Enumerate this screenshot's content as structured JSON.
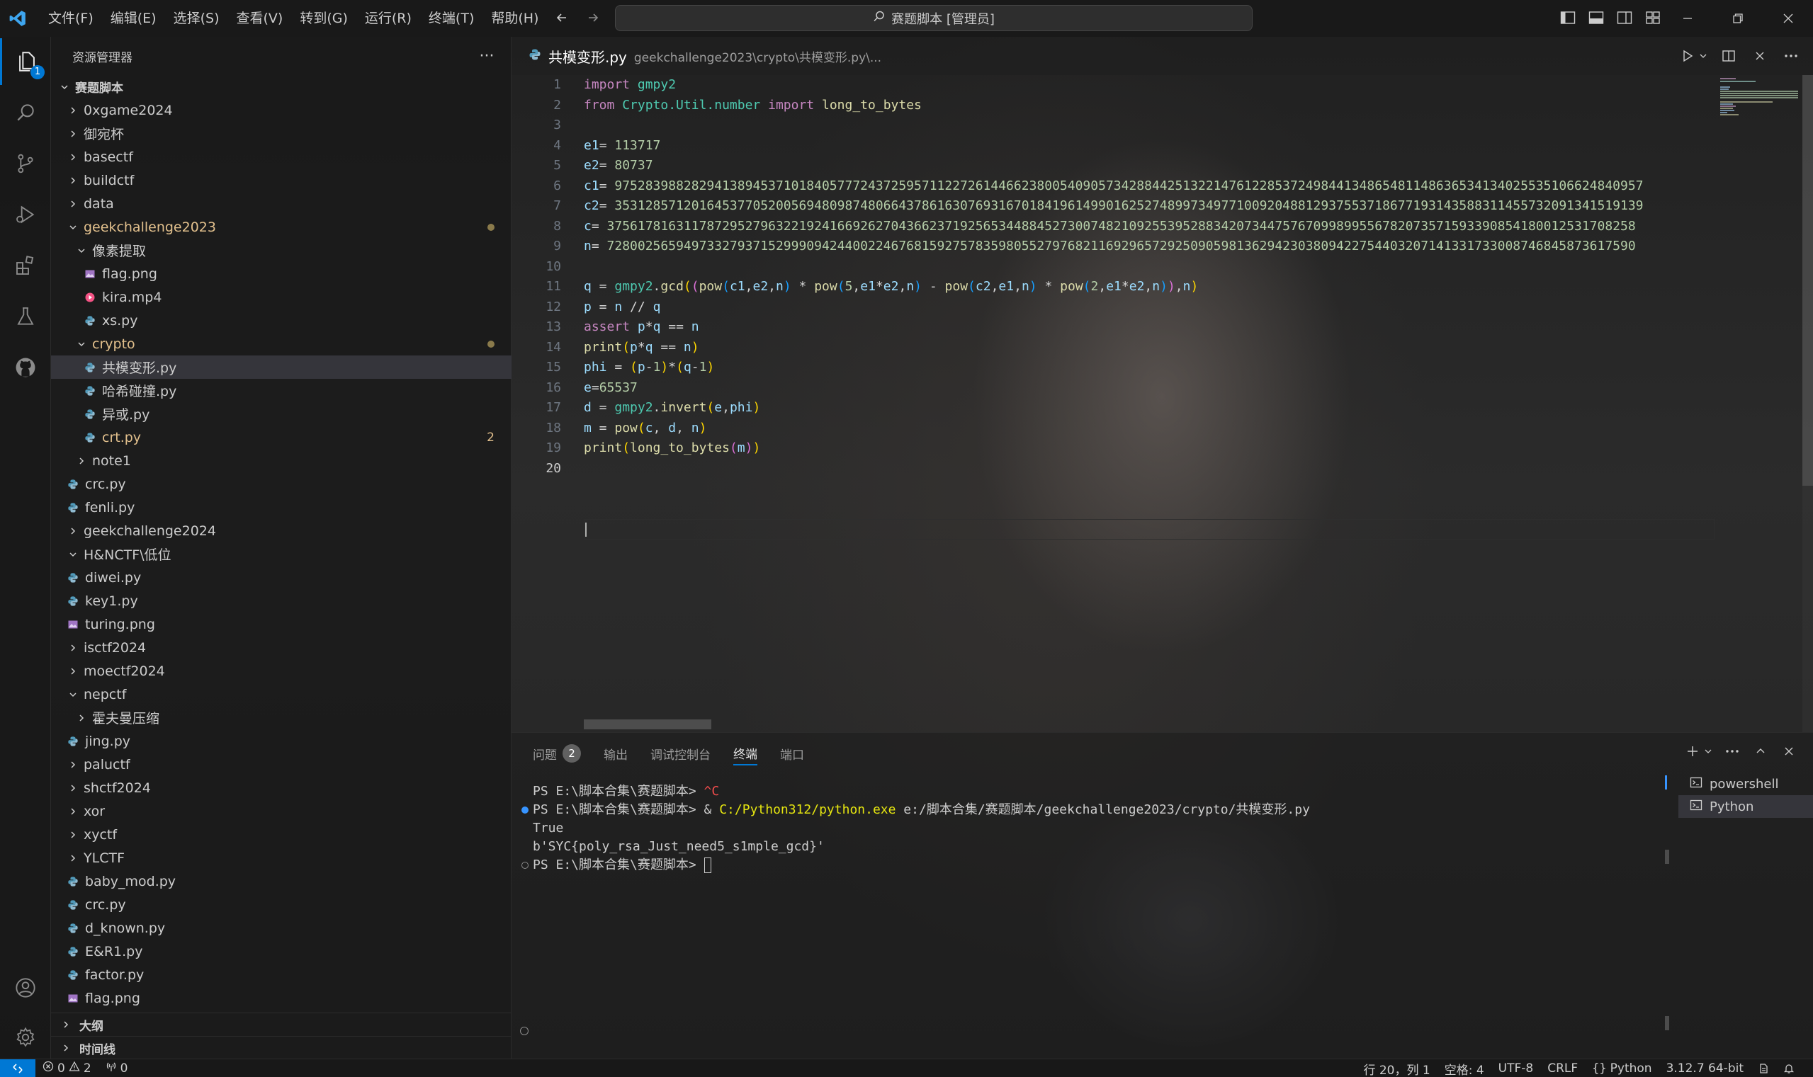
{
  "titlebar": {
    "menu": [
      "文件(F)",
      "编辑(E)",
      "选择(S)",
      "查看(V)",
      "转到(G)",
      "运行(R)",
      "终端(T)",
      "帮助(H)"
    ],
    "command_center": "赛题脚本 [管理员]"
  },
  "activity": {
    "explorer_badge": "1"
  },
  "sidebar": {
    "title": "资源管理器",
    "more": "···",
    "tree": [
      {
        "label": "赛题脚本",
        "depth": 0,
        "type": "root",
        "chev": "open"
      },
      {
        "label": "0xgame2024",
        "depth": 1,
        "type": "folder",
        "chev": "closed"
      },
      {
        "label": "御宛杯",
        "depth": 1,
        "type": "folder",
        "chev": "closed"
      },
      {
        "label": "basectf",
        "depth": 1,
        "type": "folder",
        "chev": "closed"
      },
      {
        "label": "buildctf",
        "depth": 1,
        "type": "folder",
        "chev": "closed"
      },
      {
        "label": "data",
        "depth": 1,
        "type": "folder",
        "chev": "closed"
      },
      {
        "label": "geekchallenge2023",
        "depth": 1,
        "type": "folder",
        "chev": "open",
        "modified": true,
        "dot": true
      },
      {
        "label": "像素提取",
        "depth": 2,
        "type": "folder",
        "chev": "open"
      },
      {
        "label": "flag.png",
        "depth": 3,
        "type": "image"
      },
      {
        "label": "kira.mp4",
        "depth": 3,
        "type": "video"
      },
      {
        "label": "xs.py",
        "depth": 3,
        "type": "python"
      },
      {
        "label": "crypto",
        "depth": 2,
        "type": "folder",
        "chev": "open",
        "modified": true,
        "dot": true
      },
      {
        "label": "共模变形.py",
        "depth": 3,
        "type": "python",
        "selected": true
      },
      {
        "label": "哈希碰撞.py",
        "depth": 3,
        "type": "python"
      },
      {
        "label": "异或.py",
        "depth": 3,
        "type": "python"
      },
      {
        "label": "crt.py",
        "depth": 3,
        "type": "python",
        "modified": true,
        "count": "2"
      },
      {
        "label": "note1",
        "depth": 2,
        "type": "folder",
        "chev": "closed"
      },
      {
        "label": "crc.py",
        "depth": 2,
        "type": "python"
      },
      {
        "label": "fenli.py",
        "depth": 2,
        "type": "python"
      },
      {
        "label": "geekchallenge2024",
        "depth": 1,
        "type": "folder",
        "chev": "closed"
      },
      {
        "label": "H&NCTF\\低位",
        "depth": 1,
        "type": "folder",
        "chev": "open"
      },
      {
        "label": "diwei.py",
        "depth": 2,
        "type": "python"
      },
      {
        "label": "key1.py",
        "depth": 2,
        "type": "python"
      },
      {
        "label": "turing.png",
        "depth": 2,
        "type": "image"
      },
      {
        "label": "isctf2024",
        "depth": 1,
        "type": "folder",
        "chev": "closed"
      },
      {
        "label": "moectf2024",
        "depth": 1,
        "type": "folder",
        "chev": "closed"
      },
      {
        "label": "nepctf",
        "depth": 1,
        "type": "folder",
        "chev": "open"
      },
      {
        "label": "霍夫曼压缩",
        "depth": 2,
        "type": "folder",
        "chev": "closed"
      },
      {
        "label": "jing.py",
        "depth": 2,
        "type": "python"
      },
      {
        "label": "paluctf",
        "depth": 1,
        "type": "folder",
        "chev": "closed"
      },
      {
        "label": "shctf2024",
        "depth": 1,
        "type": "folder",
        "chev": "closed"
      },
      {
        "label": "xor",
        "depth": 1,
        "type": "folder",
        "chev": "closed"
      },
      {
        "label": "xyctf",
        "depth": 1,
        "type": "folder",
        "chev": "closed"
      },
      {
        "label": "YLCTF",
        "depth": 1,
        "type": "folder",
        "chev": "closed"
      },
      {
        "label": "baby_mod.py",
        "depth": 1,
        "type": "python"
      },
      {
        "label": "crc.py",
        "depth": 1,
        "type": "python"
      },
      {
        "label": "d_known.py",
        "depth": 1,
        "type": "python"
      },
      {
        "label": "E&R1.py",
        "depth": 1,
        "type": "python"
      },
      {
        "label": "factor.py",
        "depth": 1,
        "type": "python"
      },
      {
        "label": "flag.png",
        "depth": 1,
        "type": "image"
      }
    ],
    "outline": "大纲",
    "timeline": "时间线"
  },
  "editor": {
    "tab_title": "共模变形.py",
    "tab_path": "geekchallenge2023\\crypto\\共模变形.py\\...",
    "current_line": 20,
    "lines": [
      [
        [
          "kw",
          "import"
        ],
        [
          "op",
          " "
        ],
        [
          "mod",
          "gmpy2"
        ]
      ],
      [
        [
          "kw",
          "from"
        ],
        [
          "op",
          " "
        ],
        [
          "mod",
          "Crypto.Util.number"
        ],
        [
          "op",
          " "
        ],
        [
          "kw",
          "import"
        ],
        [
          "op",
          " "
        ],
        [
          "fn",
          "long_to_bytes"
        ]
      ],
      [],
      [
        [
          "var",
          "e1"
        ],
        [
          "op",
          "= "
        ],
        [
          "num",
          "113717"
        ]
      ],
      [
        [
          "var",
          "e2"
        ],
        [
          "op",
          "= "
        ],
        [
          "num",
          "80737"
        ]
      ],
      [
        [
          "var",
          "c1"
        ],
        [
          "op",
          "= "
        ],
        [
          "num",
          "97528398828294138945371018405777243725957112272614466238005409057342884425132214761228537249844134865481148636534134025535106624840957"
        ]
      ],
      [
        [
          "var",
          "c2"
        ],
        [
          "op",
          "= "
        ],
        [
          "num",
          "35312857120164537705200569480987480664378616307693167018419614990162527489973497710092048812937553718677193143588311455732091341519139"
        ]
      ],
      [
        [
          "var",
          "c"
        ],
        [
          "op",
          "= "
        ],
        [
          "num",
          "37561781631178729527963221924166926270436623719256534488452730074821092553952883420734475767099899556782073571593390854180012531708258"
        ]
      ],
      [
        [
          "var",
          "n"
        ],
        [
          "op",
          "= "
        ],
        [
          "num",
          "72800256594973327937152999094244002246768159275783598055279768211692965729250905981362942303809422754403207141331733008746845873617590"
        ]
      ],
      [],
      [
        [
          "var",
          "q"
        ],
        [
          "op",
          " = "
        ],
        [
          "mod",
          "gmpy2"
        ],
        [
          "op",
          "."
        ],
        [
          "fn",
          "gcd"
        ],
        [
          "p1",
          "("
        ],
        [
          "p2",
          "("
        ],
        [
          "fn",
          "pow"
        ],
        [
          "p3",
          "("
        ],
        [
          "var",
          "c1"
        ],
        [
          "op",
          ","
        ],
        [
          "var",
          "e2"
        ],
        [
          "op",
          ","
        ],
        [
          "var",
          "n"
        ],
        [
          "p3",
          ")"
        ],
        [
          "op",
          " * "
        ],
        [
          "fn",
          "pow"
        ],
        [
          "p3",
          "("
        ],
        [
          "num",
          "5"
        ],
        [
          "op",
          ","
        ],
        [
          "var",
          "e1"
        ],
        [
          "op",
          "*"
        ],
        [
          "var",
          "e2"
        ],
        [
          "op",
          ","
        ],
        [
          "var",
          "n"
        ],
        [
          "p3",
          ")"
        ],
        [
          "op",
          " - "
        ],
        [
          "fn",
          "pow"
        ],
        [
          "p3",
          "("
        ],
        [
          "var",
          "c2"
        ],
        [
          "op",
          ","
        ],
        [
          "var",
          "e1"
        ],
        [
          "op",
          ","
        ],
        [
          "var",
          "n"
        ],
        [
          "p3",
          ")"
        ],
        [
          "op",
          " * "
        ],
        [
          "fn",
          "pow"
        ],
        [
          "p3",
          "("
        ],
        [
          "num",
          "2"
        ],
        [
          "op",
          ","
        ],
        [
          "var",
          "e1"
        ],
        [
          "op",
          "*"
        ],
        [
          "var",
          "e2"
        ],
        [
          "op",
          ","
        ],
        [
          "var",
          "n"
        ],
        [
          "p3",
          ")"
        ],
        [
          "p2",
          ")"
        ],
        [
          "op",
          ","
        ],
        [
          "var",
          "n"
        ],
        [
          "p1",
          ")"
        ]
      ],
      [
        [
          "var",
          "p"
        ],
        [
          "op",
          " = "
        ],
        [
          "var",
          "n"
        ],
        [
          "op",
          " // "
        ],
        [
          "var",
          "q"
        ]
      ],
      [
        [
          "kw",
          "assert"
        ],
        [
          "op",
          " "
        ],
        [
          "var",
          "p"
        ],
        [
          "op",
          "*"
        ],
        [
          "var",
          "q"
        ],
        [
          "op",
          " == "
        ],
        [
          "var",
          "n"
        ]
      ],
      [
        [
          "fn",
          "print"
        ],
        [
          "p1",
          "("
        ],
        [
          "var",
          "p"
        ],
        [
          "op",
          "*"
        ],
        [
          "var",
          "q"
        ],
        [
          "op",
          " == "
        ],
        [
          "var",
          "n"
        ],
        [
          "p1",
          ")"
        ]
      ],
      [
        [
          "var",
          "phi"
        ],
        [
          "op",
          " = "
        ],
        [
          "p1",
          "("
        ],
        [
          "var",
          "p"
        ],
        [
          "op",
          "-"
        ],
        [
          "num",
          "1"
        ],
        [
          "p1",
          ")"
        ],
        [
          "op",
          "*"
        ],
        [
          "p1",
          "("
        ],
        [
          "var",
          "q"
        ],
        [
          "op",
          "-"
        ],
        [
          "num",
          "1"
        ],
        [
          "p1",
          ")"
        ]
      ],
      [
        [
          "var",
          "e"
        ],
        [
          "op",
          "="
        ],
        [
          "num",
          "65537"
        ]
      ],
      [
        [
          "var",
          "d"
        ],
        [
          "op",
          " = "
        ],
        [
          "mod",
          "gmpy2"
        ],
        [
          "op",
          "."
        ],
        [
          "fn",
          "invert"
        ],
        [
          "p1",
          "("
        ],
        [
          "var",
          "e"
        ],
        [
          "op",
          ","
        ],
        [
          "var",
          "phi"
        ],
        [
          "p1",
          ")"
        ]
      ],
      [
        [
          "var",
          "m"
        ],
        [
          "op",
          " = "
        ],
        [
          "fn",
          "pow"
        ],
        [
          "p1",
          "("
        ],
        [
          "var",
          "c"
        ],
        [
          "op",
          ", "
        ],
        [
          "var",
          "d"
        ],
        [
          "op",
          ", "
        ],
        [
          "var",
          "n"
        ],
        [
          "p1",
          ")"
        ]
      ],
      [
        [
          "fn",
          "print"
        ],
        [
          "p1",
          "("
        ],
        [
          "fn",
          "long_to_bytes"
        ],
        [
          "p2",
          "("
        ],
        [
          "var",
          "m"
        ],
        [
          "p2",
          ")"
        ],
        [
          "p1",
          ")"
        ]
      ],
      []
    ]
  },
  "panel": {
    "tabs": [
      {
        "label": "问题",
        "badge": "2"
      },
      {
        "label": "输出"
      },
      {
        "label": "调试控制台"
      },
      {
        "label": "终端",
        "active": true
      },
      {
        "label": "端口"
      }
    ],
    "terminal": [
      {
        "deco": "",
        "segs": [
          [
            "",
            "PS E:\\脚本合集\\赛题脚本> "
          ],
          [
            "red",
            "^C"
          ]
        ]
      },
      {
        "deco": "ok",
        "segs": [
          [
            "",
            "PS E:\\脚本合集\\赛题脚本> & "
          ],
          [
            "yellow",
            "C:/Python312/python.exe"
          ],
          [
            "",
            " e:/脚本合集/赛题脚本/geekchallenge2023/crypto/共模变形.py"
          ]
        ]
      },
      {
        "deco": "",
        "segs": [
          [
            "",
            "True"
          ]
        ]
      },
      {
        "deco": "",
        "segs": [
          [
            "",
            "b'SYC{poly_rsa_Just_need5_s1mple_gcd}'"
          ]
        ]
      },
      {
        "deco": "empty",
        "segs": [
          [
            "",
            "PS E:\\脚本合集\\赛题脚本> "
          ]
        ],
        "cursor": true
      }
    ],
    "profiles": [
      "powershell",
      "Python"
    ]
  },
  "status": {
    "errors": "0",
    "warnings": "2",
    "ports": "0",
    "position": "行 20，列 1",
    "spaces": "空格: 4",
    "encoding": "UTF-8",
    "eol": "CRLF",
    "language": "Python",
    "interpreter": "3.12.7 64-bit"
  }
}
